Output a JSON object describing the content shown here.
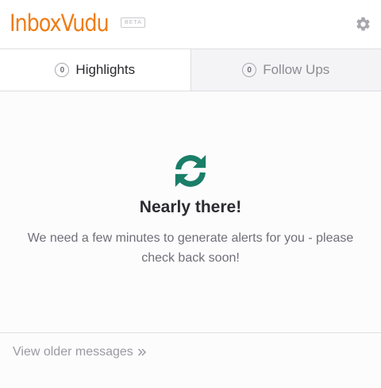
{
  "header": {
    "logo_text": "InboxVudu",
    "beta_label": "BETA",
    "settings_icon": "gear-icon"
  },
  "tabs": [
    {
      "label": "Highlights",
      "count": "0",
      "active": true
    },
    {
      "label": "Follow Ups",
      "count": "0",
      "active": false
    }
  ],
  "main": {
    "icon": "sync-icon",
    "icon_color": "#1a7e68",
    "title": "Nearly there!",
    "message": "We need a few minutes to generate alerts for you - please check back soon!"
  },
  "footer": {
    "link_label": "View older messages",
    "link_icon": "double-chevron-right-icon"
  },
  "colors": {
    "brand": "#ef7d16",
    "accent": "#1a7e68"
  }
}
